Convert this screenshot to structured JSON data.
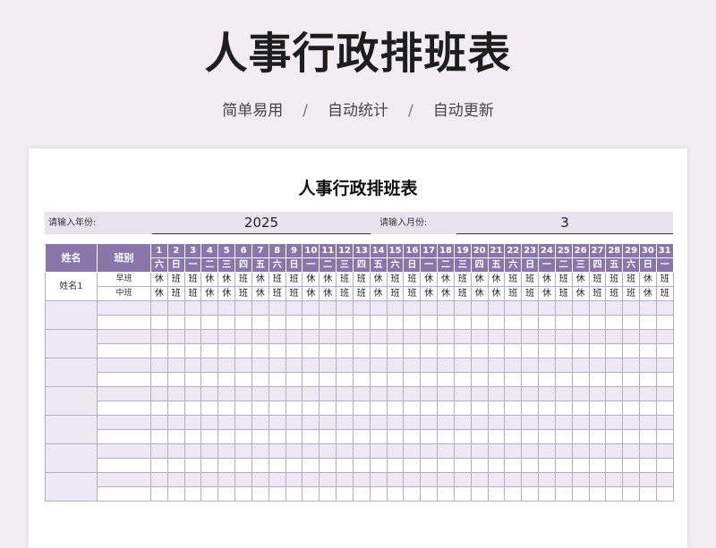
{
  "hero": {
    "title": "人事行政排班表",
    "tags": [
      "简单易用",
      "自动统计",
      "自动更新"
    ],
    "separator": "/"
  },
  "sheet": {
    "title": "人事行政排班表",
    "year_label": "请输入年份:",
    "year_value": "2025",
    "month_label": "请输入月份:",
    "month_value": "3"
  },
  "table": {
    "header_name": "姓名",
    "header_shift": "班别",
    "days": [
      "1",
      "2",
      "3",
      "4",
      "5",
      "6",
      "7",
      "8",
      "9",
      "10",
      "11",
      "12",
      "13",
      "14",
      "15",
      "16",
      "17",
      "18",
      "19",
      "20",
      "21",
      "22",
      "23",
      "24",
      "25",
      "26",
      "27",
      "28",
      "29",
      "30",
      "31"
    ],
    "weekdays": [
      "六",
      "日",
      "一",
      "二",
      "三",
      "四",
      "五",
      "六",
      "日",
      "一",
      "二",
      "三",
      "四",
      "五",
      "六",
      "日",
      "一",
      "二",
      "三",
      "四",
      "五",
      "六",
      "日",
      "一",
      "二",
      "三",
      "四",
      "五",
      "六",
      "日",
      "一"
    ],
    "employees": [
      {
        "name": "姓名1",
        "shifts": [
          {
            "label": "早班",
            "cells": [
              "休",
              "班",
              "班",
              "休",
              "休",
              "班",
              "休",
              "班",
              "班",
              "休",
              "休",
              "班",
              "班",
              "休",
              "班",
              "班",
              "休",
              "休",
              "班",
              "休",
              "休",
              "班",
              "班",
              "休",
              "班",
              "休",
              "班",
              "班",
              "班",
              "休",
              "班"
            ]
          },
          {
            "label": "中班",
            "cells": [
              "休",
              "班",
              "班",
              "休",
              "休",
              "班",
              "休",
              "班",
              "班",
              "休",
              "休",
              "班",
              "班",
              "休",
              "班",
              "班",
              "休",
              "休",
              "班",
              "休",
              "休",
              "班",
              "班",
              "休",
              "班",
              "休",
              "班",
              "班",
              "班",
              "休",
              "班"
            ]
          }
        ]
      },
      {
        "name": "",
        "shifts": [
          {
            "label": "",
            "cells": []
          },
          {
            "label": "",
            "cells": []
          }
        ]
      },
      {
        "name": "",
        "shifts": [
          {
            "label": "",
            "cells": []
          },
          {
            "label": "",
            "cells": []
          }
        ]
      },
      {
        "name": "",
        "shifts": [
          {
            "label": "",
            "cells": []
          },
          {
            "label": "",
            "cells": []
          }
        ]
      },
      {
        "name": "",
        "shifts": [
          {
            "label": "",
            "cells": []
          },
          {
            "label": "",
            "cells": []
          }
        ]
      },
      {
        "name": "",
        "shifts": [
          {
            "label": "",
            "cells": []
          },
          {
            "label": "",
            "cells": []
          }
        ]
      },
      {
        "name": "",
        "shifts": [
          {
            "label": "",
            "cells": []
          },
          {
            "label": "",
            "cells": []
          }
        ]
      },
      {
        "name": "",
        "shifts": [
          {
            "label": "",
            "cells": []
          },
          {
            "label": "",
            "cells": []
          }
        ]
      }
    ]
  },
  "colors": {
    "header_bg": "#8a76ab",
    "shade_bg": "#ece9f2",
    "border": "#b4abc7"
  }
}
